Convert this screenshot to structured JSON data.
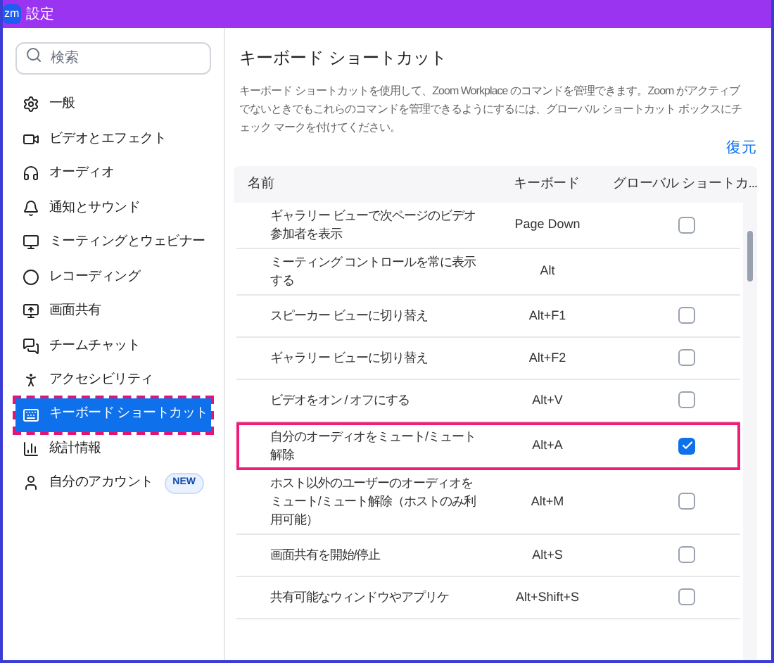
{
  "window": {
    "title": "設定",
    "logo": "zm"
  },
  "search": {
    "placeholder": "検索"
  },
  "sidebar": {
    "items": [
      {
        "label": "一般",
        "selected": false
      },
      {
        "label": "ビデオとエフェクト",
        "selected": false
      },
      {
        "label": "オーディオ",
        "selected": false
      },
      {
        "label": "通知とサウンド",
        "selected": false
      },
      {
        "label": "ミーティングとウェビナー",
        "selected": false
      },
      {
        "label": "レコーディング",
        "selected": false
      },
      {
        "label": "画面共有",
        "selected": false
      },
      {
        "label": "チームチャット",
        "selected": false
      },
      {
        "label": "アクセシビリティ",
        "selected": false
      },
      {
        "label": "キーボード ショートカット",
        "selected": true
      },
      {
        "label": "統計情報",
        "selected": false
      },
      {
        "label": "自分のアカウント",
        "selected": false,
        "badge": "NEW"
      }
    ]
  },
  "content": {
    "title": "キーボード ショートカット",
    "description": "キーボード ショートカットを使用して、Zoom Workplace のコマンドを管理できます。Zoom がアクティブでないときでもこれらのコマンドを管理できるようにするには、グローバル ショートカット ボックスにチェック マークを付けてください。",
    "restore_link": "復元"
  },
  "table": {
    "columns": [
      "名前",
      "キーボード",
      "グローバル ショートカ..."
    ],
    "rows": [
      {
        "name": "ギャラリー ビューで次ページのビデオ参加者を表示",
        "key": "Page Down",
        "kind": "checkbox",
        "checked": false,
        "highlighted": false
      },
      {
        "name": "ミーティング コントロールを常に表示する",
        "key": "Alt",
        "kind": "plain",
        "highlighted": false
      },
      {
        "name": "スピーカー ビューに切り替え",
        "key": "Alt+F1",
        "kind": "checkbox",
        "checked": false,
        "highlighted": false
      },
      {
        "name": "ギャラリー ビューに切り替え",
        "key": "Alt+F2",
        "kind": "checkbox",
        "checked": false,
        "highlighted": false
      },
      {
        "name": "ビデオをオン / オフにする",
        "key": "Alt+V",
        "kind": "checkbox",
        "checked": false,
        "highlighted": false
      },
      {
        "name": "自分のオーディオをミュート/ミュート解除",
        "key": "Alt+A",
        "kind": "checkbox",
        "checked": true,
        "highlighted": true
      },
      {
        "name": "ホスト以外のユーザーのオーディオをミュート/ミュート解除（ホストのみ利用可能）",
        "key": "Alt+M",
        "kind": "checkbox",
        "checked": false,
        "highlighted": false
      },
      {
        "name": "画面共有を開始/停止",
        "key": "Alt+S",
        "kind": "checkbox",
        "checked": false,
        "highlighted": false
      },
      {
        "name": "共有可能なウィンドウやアプリケ",
        "key": "Alt+Shift+S",
        "kind": "checkbox",
        "checked": false,
        "highlighted": false
      }
    ]
  }
}
